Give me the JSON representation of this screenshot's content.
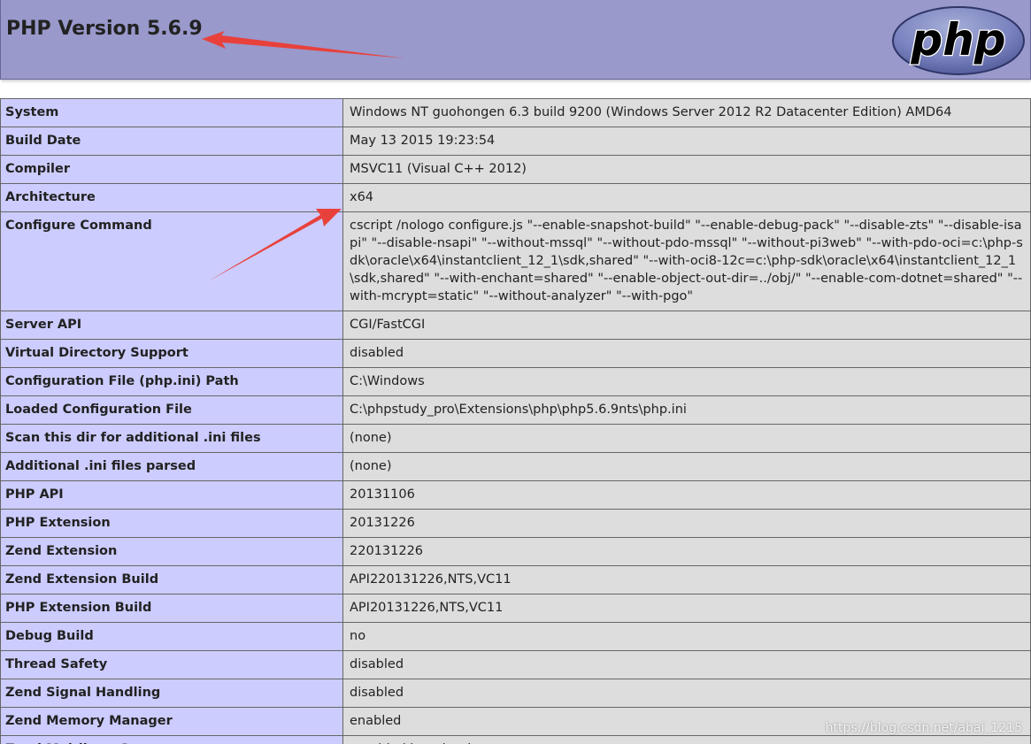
{
  "header": {
    "title": "PHP Version 5.6.9",
    "logo_text": "php",
    "background": "#9999cc"
  },
  "colors": {
    "label_cell": "#ccccff",
    "value_cell": "#dddddd",
    "annotation_arrow": "#e8413c"
  },
  "icons": [
    "php-logo-icon",
    "annotation-arrow-icon"
  ],
  "rows": [
    {
      "label": "System",
      "value": "Windows NT guohongen 6.3 build 9200 (Windows Server 2012 R2 Datacenter Edition) AMD64"
    },
    {
      "label": "Build Date",
      "value": "May 13 2015 19:23:54"
    },
    {
      "label": "Compiler",
      "value": "MSVC11 (Visual C++ 2012)"
    },
    {
      "label": "Architecture",
      "value": "x64"
    },
    {
      "label": "Configure Command",
      "value": "cscript /nologo configure.js \"--enable-snapshot-build\" \"--enable-debug-pack\" \"--disable-zts\" \"--disable-isapi\" \"--disable-nsapi\" \"--without-mssql\" \"--without-pdo-mssql\" \"--without-pi3web\" \"--with-pdo-oci=c:\\php-sdk\\oracle\\x64\\instantclient_12_1\\sdk,shared\" \"--with-oci8-12c=c:\\php-sdk\\oracle\\x64\\instantclient_12_1\\sdk,shared\" \"--with-enchant=shared\" \"--enable-object-out-dir=../obj/\" \"--enable-com-dotnet=shared\" \"--with-mcrypt=static\" \"--without-analyzer\" \"--with-pgo\""
    },
    {
      "label": "Server API",
      "value": "CGI/FastCGI"
    },
    {
      "label": "Virtual Directory Support",
      "value": "disabled"
    },
    {
      "label": "Configuration File (php.ini) Path",
      "value": "C:\\Windows"
    },
    {
      "label": "Loaded Configuration File",
      "value": "C:\\phpstudy_pro\\Extensions\\php\\php5.6.9nts\\php.ini"
    },
    {
      "label": "Scan this dir for additional .ini files",
      "value": "(none)"
    },
    {
      "label": "Additional .ini files parsed",
      "value": "(none)"
    },
    {
      "label": "PHP API",
      "value": "20131106"
    },
    {
      "label": "PHP Extension",
      "value": "20131226"
    },
    {
      "label": "Zend Extension",
      "value": "220131226"
    },
    {
      "label": "Zend Extension Build",
      "value": "API220131226,NTS,VC11"
    },
    {
      "label": "PHP Extension Build",
      "value": "API20131226,NTS,VC11"
    },
    {
      "label": "Debug Build",
      "value": "no"
    },
    {
      "label": "Thread Safety",
      "value": "disabled"
    },
    {
      "label": "Zend Signal Handling",
      "value": "disabled"
    },
    {
      "label": "Zend Memory Manager",
      "value": "enabled"
    },
    {
      "label": "Zend Multibyte Support",
      "value": "provided by mbstring"
    }
  ],
  "watermark": "https://blog.csdn.net/abai_1215"
}
